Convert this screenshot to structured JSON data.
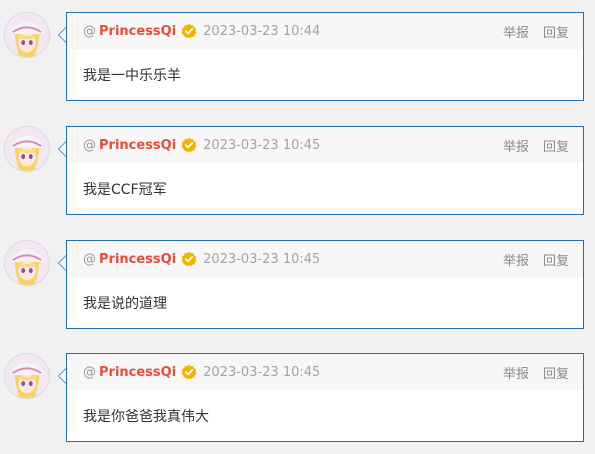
{
  "comments": [
    {
      "at": "@",
      "username": "PrincessQi",
      "timestamp": "2023-03-23 10:44",
      "report_label": "举报",
      "reply_label": "回复",
      "content": "我是一中乐乐羊"
    },
    {
      "at": "@",
      "username": "PrincessQi",
      "timestamp": "2023-03-23 10:45",
      "report_label": "举报",
      "reply_label": "回复",
      "content": "我是CCF冠军"
    },
    {
      "at": "@",
      "username": "PrincessQi",
      "timestamp": "2023-03-23 10:45",
      "report_label": "举报",
      "reply_label": "回复",
      "content": "我是说的道理"
    },
    {
      "at": "@",
      "username": "PrincessQi",
      "timestamp": "2023-03-23 10:45",
      "report_label": "举报",
      "reply_label": "回复",
      "content": "我是你爸爸我真伟大"
    }
  ],
  "colors": {
    "username": "#e74c3c",
    "verified_badge": "#f0b400",
    "card_border": "#1f6fb0"
  },
  "icons": {
    "verified": "verified-badge-icon",
    "avatar": "user-avatar"
  }
}
